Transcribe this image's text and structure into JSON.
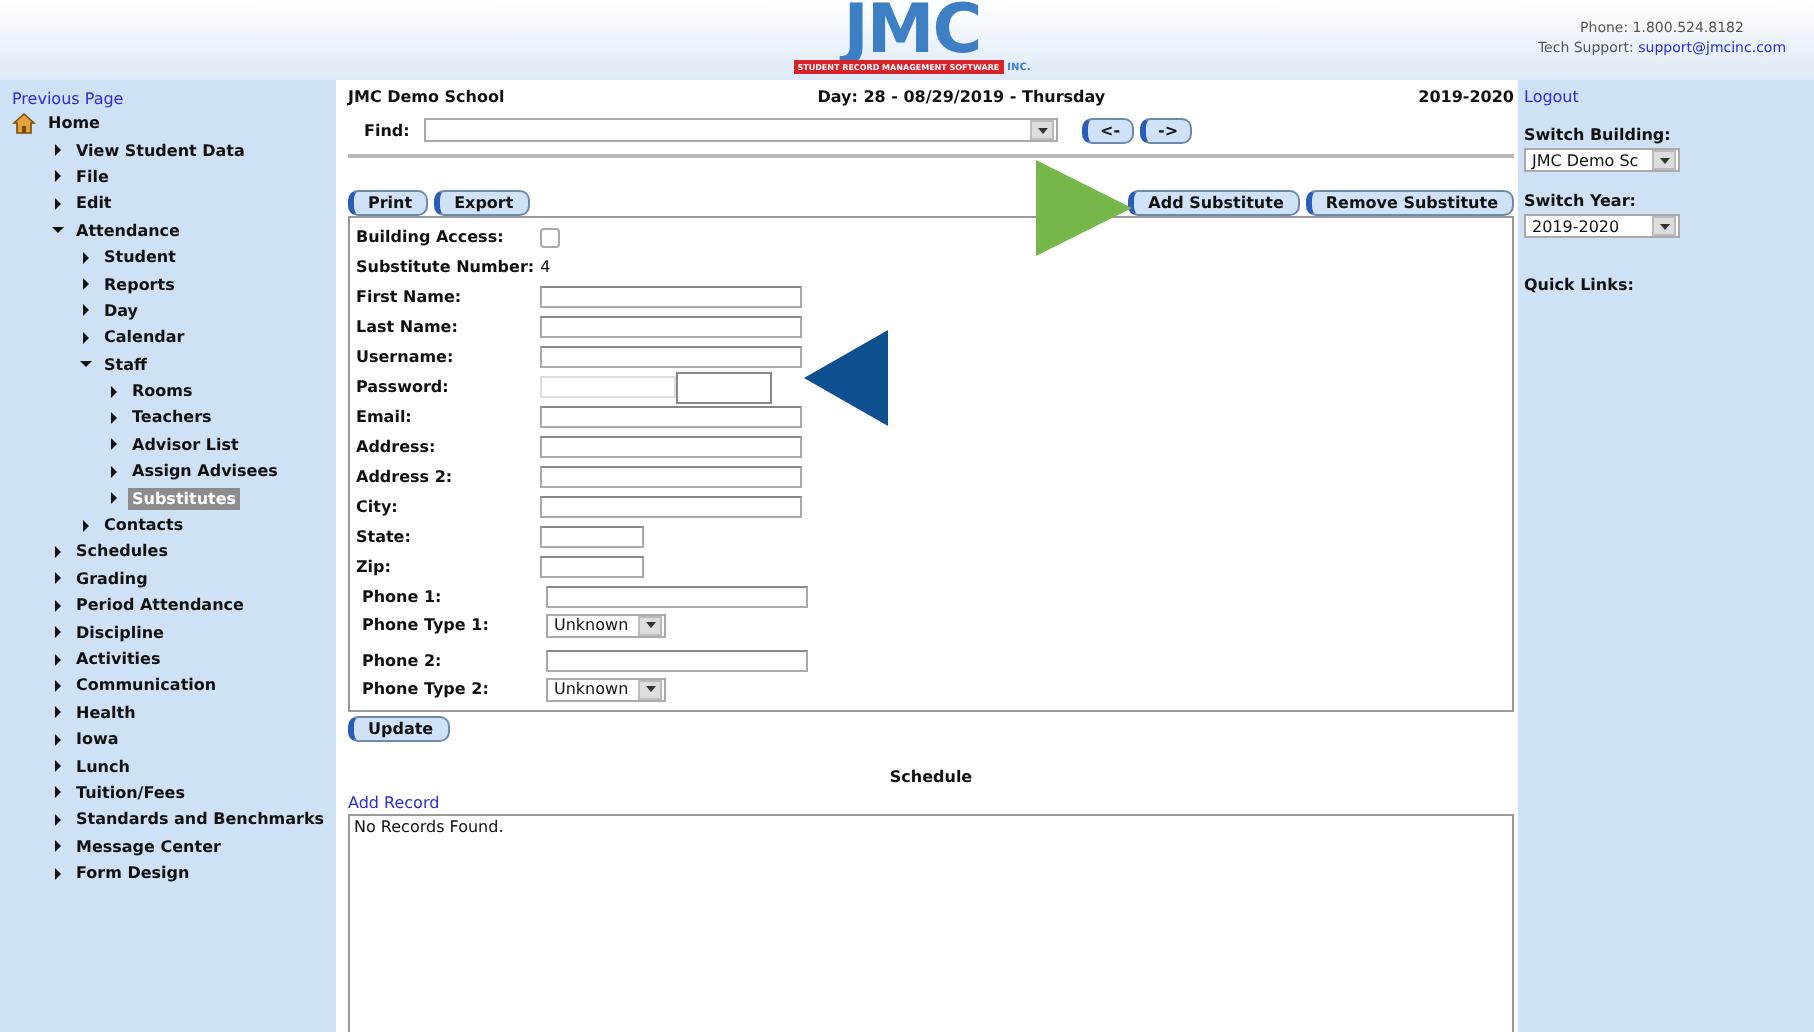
{
  "header": {
    "logo_letters": "JMC",
    "logo_band": "STUDENT RECORD MANAGEMENT SOFTWARE",
    "logo_suffix": "INC.",
    "phone": "Phone: 1.800.524.8182",
    "support_label": "Tech Support:",
    "support_email": "support@jmcinc.com"
  },
  "sidebar": {
    "previous_link": "Previous Page",
    "tree": [
      {
        "label": "Home",
        "kind": "home",
        "selected": false,
        "children": [
          {
            "label": "View Student Data",
            "kind": "node",
            "expanded": false,
            "selected": false
          },
          {
            "label": "File",
            "kind": "node",
            "expanded": false,
            "selected": false
          },
          {
            "label": "Edit",
            "kind": "node",
            "expanded": false,
            "selected": false
          },
          {
            "label": "Attendance",
            "kind": "node",
            "expanded": true,
            "selected": false,
            "children": [
              {
                "label": "Student",
                "kind": "node",
                "expanded": false,
                "selected": false
              },
              {
                "label": "Reports",
                "kind": "node",
                "expanded": false,
                "selected": false
              },
              {
                "label": "Day",
                "kind": "node",
                "expanded": false,
                "selected": false
              },
              {
                "label": "Calendar",
                "kind": "node",
                "expanded": false,
                "selected": false
              },
              {
                "label": "Staff",
                "kind": "node",
                "expanded": true,
                "selected": false,
                "children": [
                  {
                    "label": "Rooms",
                    "kind": "node",
                    "expanded": false,
                    "selected": false
                  },
                  {
                    "label": "Teachers",
                    "kind": "node",
                    "expanded": false,
                    "selected": false
                  },
                  {
                    "label": "Advisor List",
                    "kind": "node",
                    "expanded": false,
                    "selected": false
                  },
                  {
                    "label": "Assign Advisees",
                    "kind": "node",
                    "expanded": false,
                    "selected": false
                  },
                  {
                    "label": "Substitutes",
                    "kind": "node",
                    "expanded": false,
                    "selected": true
                  }
                ]
              },
              {
                "label": "Contacts",
                "kind": "node",
                "expanded": false,
                "selected": false
              }
            ]
          },
          {
            "label": "Schedules",
            "kind": "node",
            "expanded": false,
            "selected": false
          },
          {
            "label": "Grading",
            "kind": "node",
            "expanded": false,
            "selected": false
          },
          {
            "label": "Period Attendance",
            "kind": "node",
            "expanded": false,
            "selected": false
          },
          {
            "label": "Discipline",
            "kind": "node",
            "expanded": false,
            "selected": false
          },
          {
            "label": "Activities",
            "kind": "node",
            "expanded": false,
            "selected": false
          },
          {
            "label": "Communication",
            "kind": "node",
            "expanded": false,
            "selected": false
          },
          {
            "label": "Health",
            "kind": "node",
            "expanded": false,
            "selected": false
          },
          {
            "label": "Iowa",
            "kind": "node",
            "expanded": false,
            "selected": false
          },
          {
            "label": "Lunch",
            "kind": "node",
            "expanded": false,
            "selected": false
          },
          {
            "label": "Tuition/Fees",
            "kind": "node",
            "expanded": false,
            "selected": false
          },
          {
            "label": "Standards and Benchmarks",
            "kind": "node",
            "expanded": false,
            "selected": false
          },
          {
            "label": "Message Center",
            "kind": "node",
            "expanded": false,
            "selected": false
          },
          {
            "label": "Form Design",
            "kind": "node",
            "expanded": false,
            "selected": false
          }
        ]
      }
    ]
  },
  "main": {
    "school": "JMC Demo School",
    "day": "Day: 28 - 08/29/2019 - Thursday",
    "year": "2019-2020",
    "find": {
      "label": "Find:"
    },
    "nav_buttons": [
      "<-",
      "->"
    ],
    "left_buttons": [
      "Print",
      "Export"
    ],
    "right_buttons": [
      "Add Substitute",
      "Remove Substitute"
    ],
    "fields": [
      {
        "label": "Building Access:",
        "kind": "checkbox",
        "checked": false
      },
      {
        "label": "Substitute Number:",
        "kind": "text",
        "value": "4"
      },
      {
        "label": "First Name:",
        "kind": "wide"
      },
      {
        "label": "Last Name:",
        "kind": "wide"
      },
      {
        "label": "Username:",
        "kind": "wide"
      },
      {
        "label": "Password:",
        "kind": "password"
      },
      {
        "label": "Email:",
        "kind": "wide"
      },
      {
        "label": "Address:",
        "kind": "wide"
      },
      {
        "label": "Address 2:",
        "kind": "wide"
      },
      {
        "label": "City:",
        "kind": "wide"
      },
      {
        "label": "State:",
        "kind": "short"
      },
      {
        "label": "Zip:",
        "kind": "short"
      }
    ],
    "phones": [
      {
        "label": "Phone 1:",
        "type_label": "Phone Type 1:",
        "type_value": "Unknown"
      },
      {
        "label": "Phone 2:",
        "type_label": "Phone Type 2:",
        "type_value": "Unknown"
      }
    ],
    "update_button": "Update",
    "schedule": {
      "title": "Schedule",
      "add_link": "Add Record",
      "empty_text": "No Records Found."
    }
  },
  "right_panel": {
    "logout": "Logout",
    "switch_building": {
      "label": "Switch Building:",
      "value": "JMC Demo Sc"
    },
    "switch_year": {
      "label": "Switch Year:",
      "value": "2019-2020"
    },
    "quick_links": "Quick Links:"
  }
}
